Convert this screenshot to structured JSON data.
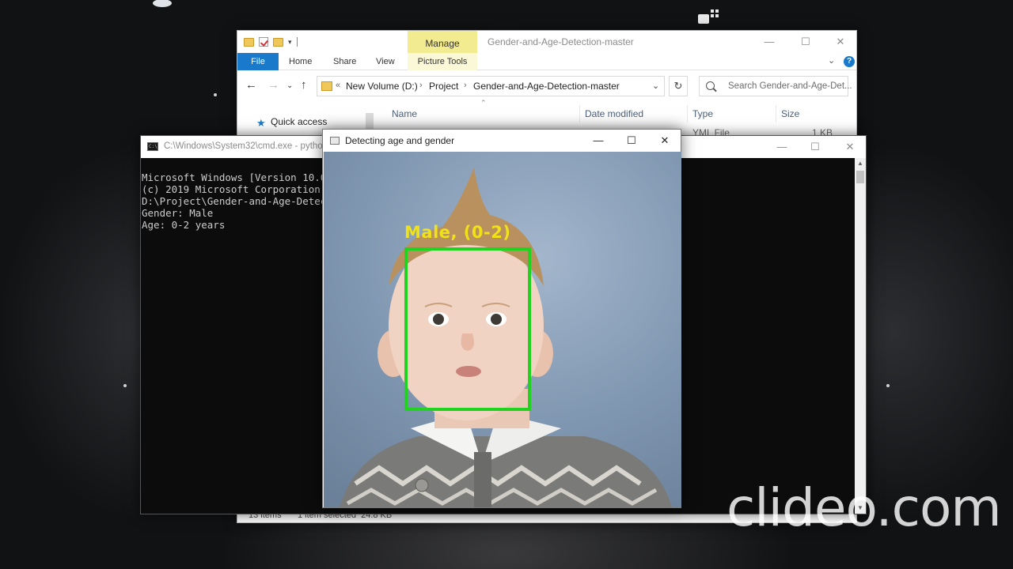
{
  "explorer": {
    "quick_access_toolbar": [
      "folder-icon",
      "properties-icon",
      "new-folder-icon",
      "customize-arrow-icon"
    ],
    "contextual_tab": "Manage",
    "title": "Gender-and-Age-Detection-master",
    "ribbon_tabs": [
      "File",
      "Home",
      "Share",
      "View",
      "Picture Tools"
    ],
    "address": {
      "prefix": "«",
      "crumbs": [
        "New Volume (D:)",
        "Project",
        "Gender-and-Age-Detection-master"
      ]
    },
    "search_placeholder": "Search Gender-and-Age-Det...",
    "nav_pane": {
      "quick_access": "Quick access"
    },
    "columns": [
      "Name",
      "Date modified",
      "Type",
      "Size"
    ],
    "visible_row": {
      "type": "YML File",
      "size": "1 KB"
    },
    "status": {
      "items": "13 items",
      "selected": "1 item selected  24.8 KB"
    }
  },
  "cmd": {
    "title": "C:\\Windows\\System32\\cmd.exe - python",
    "icon_text": "C:\\",
    "lines": [
      "Microsoft Windows [Version 10.0",
      "(c) 2019 Microsoft Corporation.",
      "",
      "D:\\Project\\Gender-and-Age-Detec",
      "Gender: Male",
      "Age: 0-2 years"
    ]
  },
  "detect_window": {
    "title": "Detecting age and gender",
    "label": "Male, (0-2)",
    "box_color": "#1fd31f",
    "label_color": "#f0e21a"
  },
  "window_controls": {
    "minimize": "—",
    "maximize": "☐",
    "close": "✕"
  },
  "watermark": "clideo.com"
}
